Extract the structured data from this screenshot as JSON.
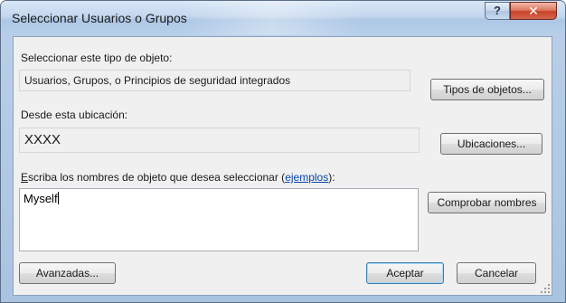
{
  "window": {
    "title": "Seleccionar Usuarios o Grupos",
    "help_label": "?",
    "close_label": "✕"
  },
  "object_type": {
    "label": "Seleccionar este tipo de objeto:",
    "value": "Usuarios, Grupos, o Principios de seguridad integrados",
    "button_label": "Tipos de objetos..."
  },
  "location": {
    "label": "Desde esta ubicación:",
    "value": "XXXX",
    "button_label": "Ubicaciones..."
  },
  "object_names": {
    "label_accel": "E",
    "label_rest": "scriba los nombres de objeto que desea seleccionar (",
    "examples_link": "ejemplos",
    "label_end": "):",
    "value": "Myself",
    "check_button_label": "Comprobar nombres"
  },
  "footer": {
    "advanced_label": "Avanzadas...",
    "ok_label": "Aceptar",
    "cancel_label": "Cancelar"
  }
}
